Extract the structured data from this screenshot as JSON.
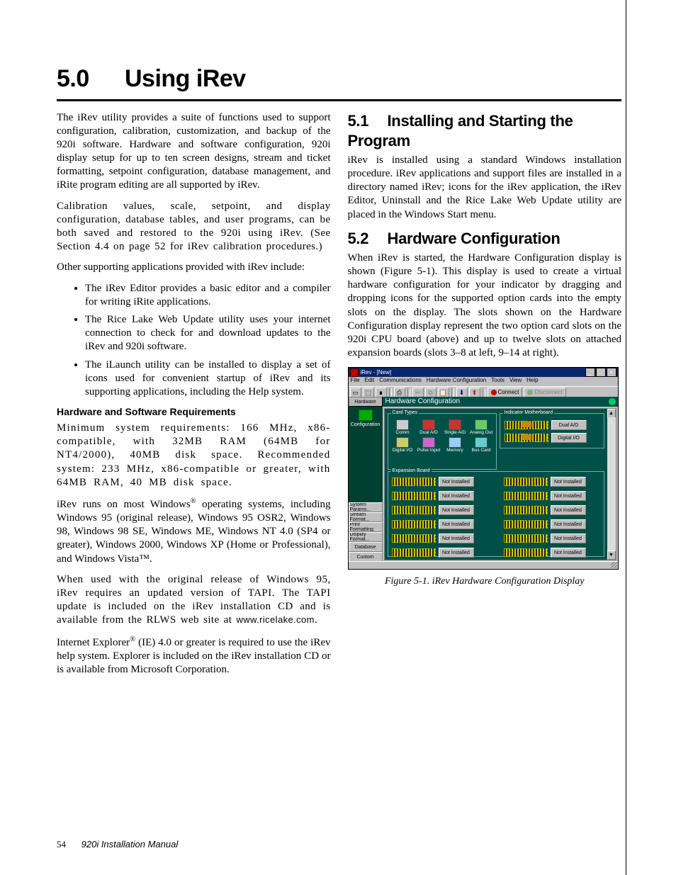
{
  "chapter": {
    "number": "5.0",
    "title": "Using iRev"
  },
  "left": {
    "p1": "The iRev utility provides a suite of functions used to support configuration, calibration, customization, and backup of the 920i software. Hardware and software configuration, 920i display setup for up to ten screen designs, stream and ticket formatting, setpoint configuration, database management, and iRite program editing are all supported by iRev.",
    "p2": "Calibration values, scale, setpoint, and display configuration, database tables, and user programs, can be both saved and restored to the 920i using iRev. (See Section 4.4 on page 52 for iRev calibration procedures.)",
    "p3": "Other supporting applications provided with iRev include:",
    "bullets": [
      "The iRev Editor provides a basic editor and a compiler for writing iRite applications.",
      "The Rice Lake Web Update utility uses your internet connection to check for and download updates to the iRev and 920i software.",
      "The iLaunch utility can be installed to display a set of icons used for convenient startup of iRev and its supporting applications, including the Help system."
    ],
    "reqhead": "Hardware and Software Requirements",
    "p4": "Minimum system requirements: 166 MHz, x86-compatible, with 32MB RAM (64MB for NT4/2000), 40MB disk space. Recommended system: 233 MHz, x86-compatible or greater, with 64MB RAM, 40 MB disk space.",
    "p5a": "iRev runs on most Windows",
    "p5b": " operating systems, including Windows 95 (original release), Windows 95 OSR2, Windows 98, Windows 98 SE, Windows ME, Windows NT 4.0 (SP4 or greater), Windows 2000, Windows XP (Home or Professional), and Windows Vista™.",
    "p6a": "When used with the original release of Windows 95, iRev requires an updated version of TAPI. The TAPI update is included on the iRev installation CD and is available from the RLWS web site at ",
    "p6b": "www.ricelake.com",
    "p6c": ".",
    "p7a": "Internet Explorer",
    "p7b": " (IE) 4.0 or greater is required to use the iRev help system. Explorer is included on the iRev installation CD or is available from Microsoft Corporation."
  },
  "right": {
    "s1": {
      "num": "5.1",
      "title": "Installing and Starting the Program",
      "p": "iRev is installed using a standard Windows installation procedure. iRev applications and support files are installed in a directory named iRev; icons for the iRev application, the iRev Editor, Uninstall and the Rice Lake Web Update utility are placed in the Windows Start menu."
    },
    "s2": {
      "num": "5.2",
      "title": "Hardware Configuration",
      "p": "When iRev is started, the Hardware Configuration display is shown (Figure 5-1). This display is used to create a virtual hardware configuration for your indicator by dragging and dropping icons for the supported option cards into the empty slots on the display. The slots shown on the Hardware Configuration display represent the two option card slots on the 920i CPU board (above) and up to twelve slots on attached expansion boards (slots 3–8 at left, 9–14 at right)."
    },
    "figcaption": "Figure 5-1. iRev Hardware Configuration Display"
  },
  "shot": {
    "title": "iRev - [New]",
    "menus": [
      "File",
      "Edit",
      "Communications",
      "Hardware Configuration",
      "Tools",
      "View",
      "Help"
    ],
    "connect": "Connect",
    "disconnect": "Disconnect",
    "side": {
      "hardware": "Hardware",
      "config": "Configuration",
      "bottom": [
        "System Params...",
        "Stream Format...",
        "Print Formatting",
        "Display Format...",
        "Database",
        "Custom"
      ]
    },
    "mainTitle": "Hardware Configuration",
    "groupCards": "Card Types",
    "groupMobo": "Indicator Motherboard",
    "groupExp": "Expansion Board",
    "cards": [
      "Comm",
      "Dual A/D",
      "Single A/D",
      "Analog Out",
      "Digital I/O",
      "Pulse Input",
      "Memory",
      "Bus Card"
    ],
    "moboSlots": [
      "Dual A/D",
      "Digital I/O"
    ],
    "notInstalled": "Not Installed"
  },
  "footer": {
    "page": "54",
    "manual": "920i Installation Manual"
  }
}
